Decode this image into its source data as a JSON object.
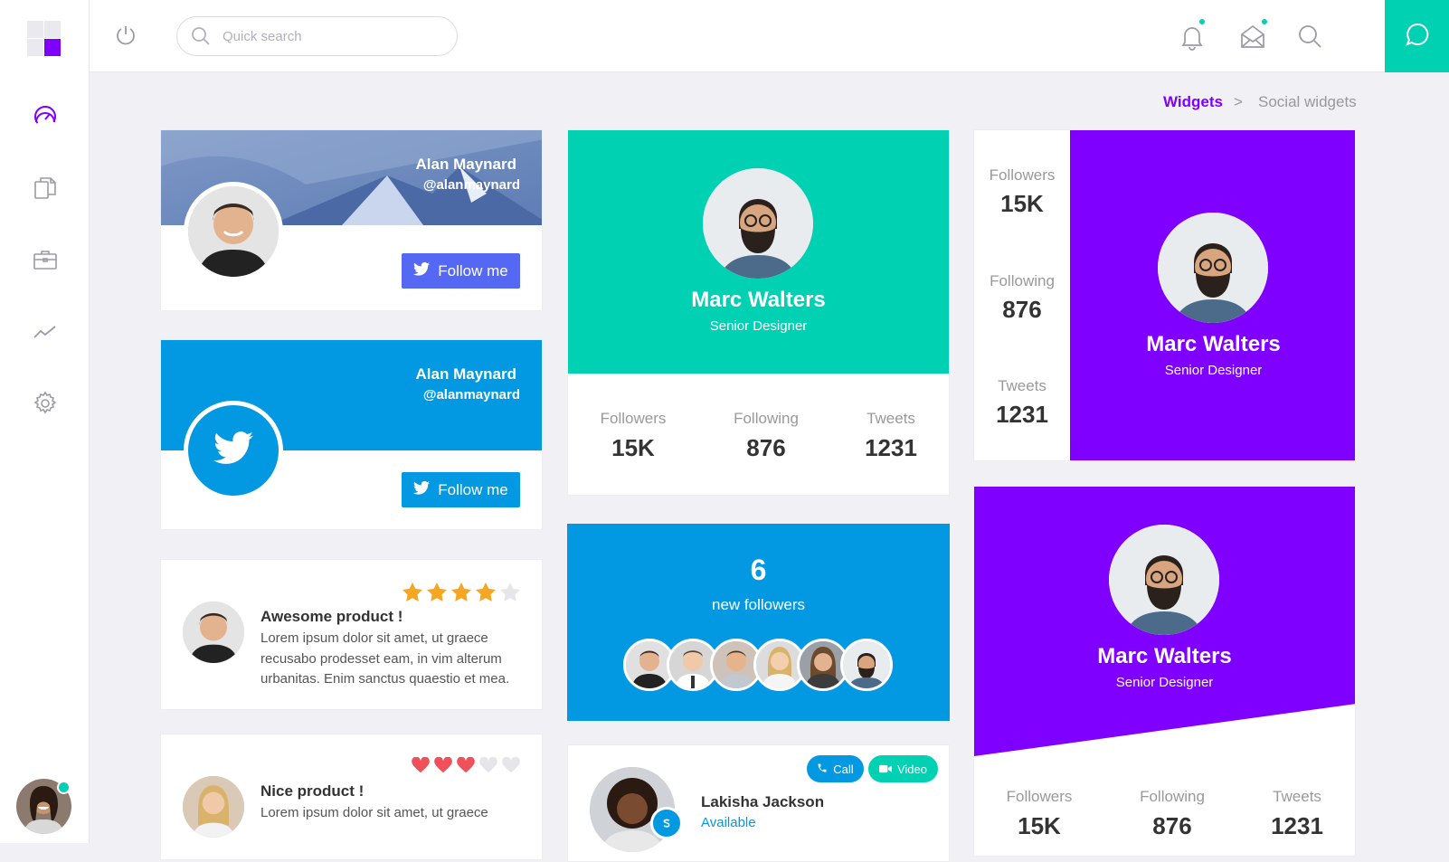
{
  "search": {
    "placeholder": "Quick search"
  },
  "breadcrumb": {
    "section": "Widgets",
    "separator": ">",
    "page": "Social widgets"
  },
  "colors": {
    "accent_purple": "#7f00ff",
    "teal": "#00d1b2",
    "twitter_blue": "#0398e2",
    "follow_blue": "#5468f4"
  },
  "icons": {
    "sidebar": [
      "dashboard-icon",
      "documents-icon",
      "briefcase-icon",
      "chart-icon",
      "settings-icon"
    ],
    "topbar": [
      "power-icon",
      "search-icon",
      "bell-icon",
      "mail-icon",
      "search-icon",
      "chat-icon"
    ]
  },
  "profile_card_1": {
    "name": "Alan Maynard",
    "handle": "@alanmaynard",
    "button": "Follow me"
  },
  "profile_card_2": {
    "name": "Alan Maynard",
    "handle": "@alanmaynard",
    "button": "Follow me"
  },
  "review_1": {
    "title": "Awesome product !",
    "text": "Lorem ipsum dolor sit amet, ut graece recusabo prodesset eam, in vim alterum urbanitas. Enim sanctus quaestio et mea.",
    "rating": 4,
    "max": 5
  },
  "review_2": {
    "title": "Nice product !",
    "text": "Lorem ipsum dolor sit amet, ut graece",
    "rating": 3,
    "max": 5
  },
  "teal_card": {
    "name": "Marc Walters",
    "role": "Senior Designer",
    "stats": [
      {
        "label": "Followers",
        "value": "15K"
      },
      {
        "label": "Following",
        "value": "876"
      },
      {
        "label": "Tweets",
        "value": "1231"
      }
    ]
  },
  "followers_card": {
    "count": "6",
    "label": "new followers"
  },
  "contact_card": {
    "name": "Lakisha Jackson",
    "status": "Available",
    "call": "Call",
    "video": "Video"
  },
  "side_stats_card": {
    "name": "Marc Walters",
    "role": "Senior Designer",
    "stats": [
      {
        "label": "Followers",
        "value": "15K"
      },
      {
        "label": "Following",
        "value": "876"
      },
      {
        "label": "Tweets",
        "value": "1231"
      }
    ]
  },
  "purple_card": {
    "name": "Marc Walters",
    "role": "Senior Designer",
    "stats": [
      {
        "label": "Followers",
        "value": "15K"
      },
      {
        "label": "Following",
        "value": "876"
      },
      {
        "label": "Tweets",
        "value": "1231"
      }
    ]
  }
}
